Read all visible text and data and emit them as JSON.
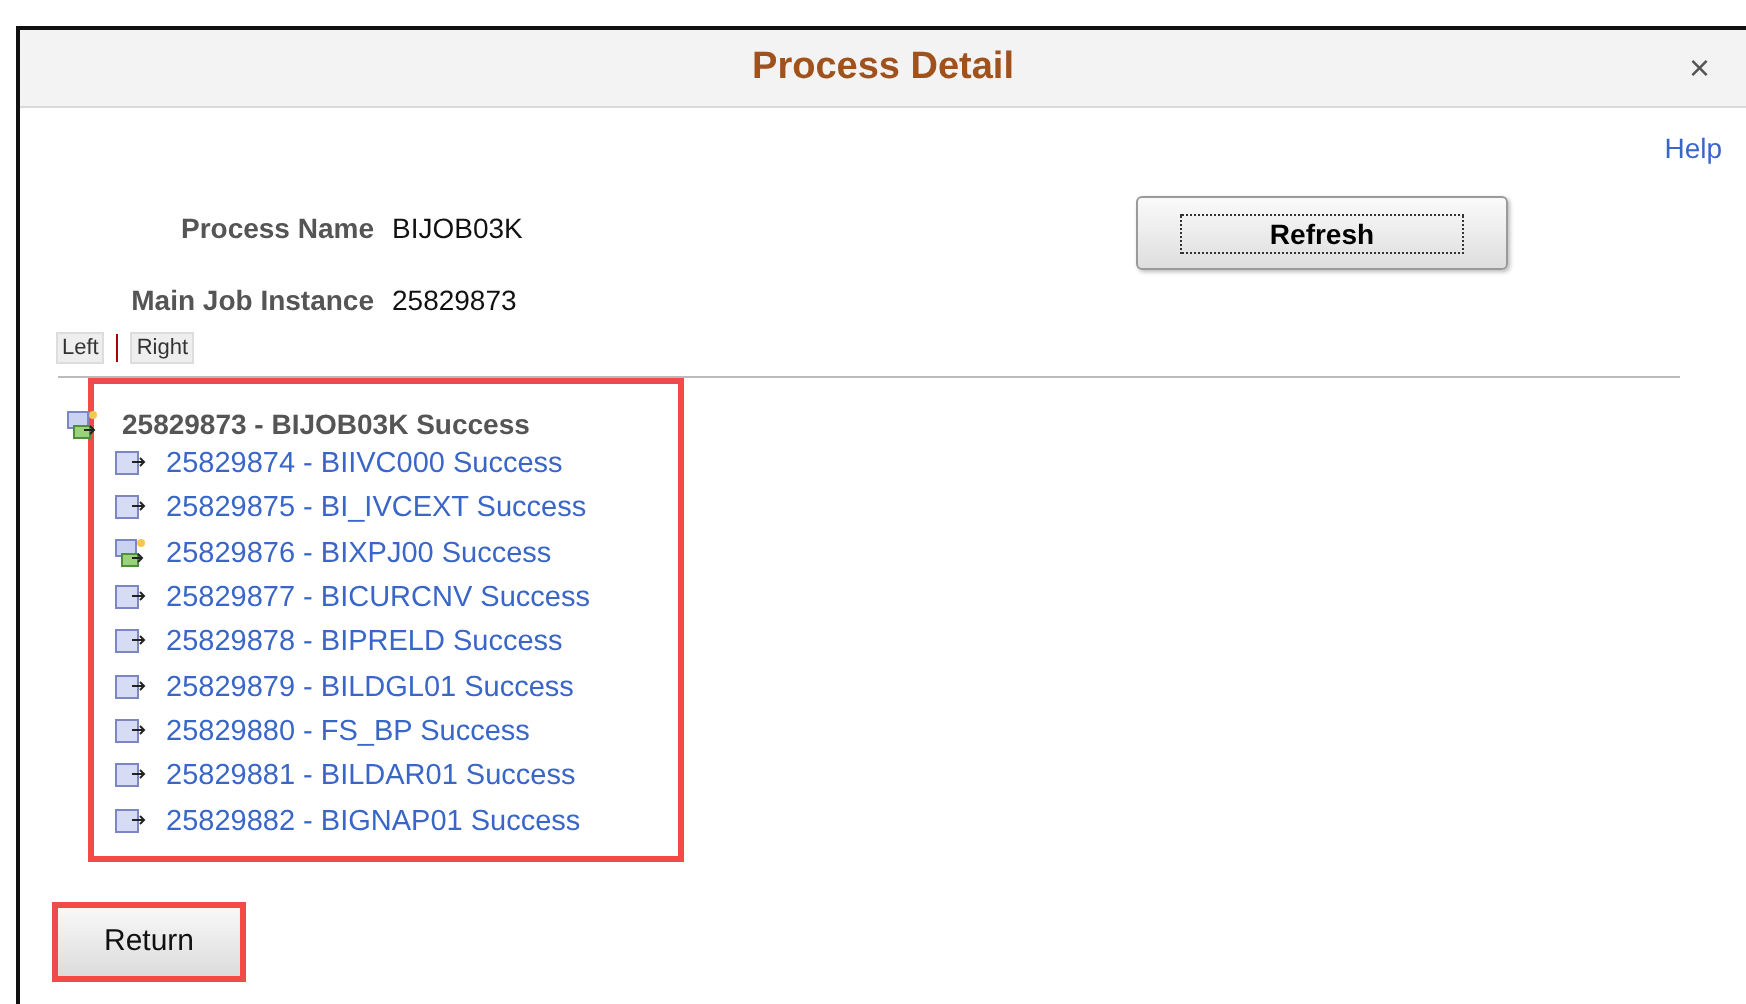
{
  "window": {
    "title": "Process Detail",
    "close": "×"
  },
  "help": "Help",
  "refresh": "Refresh",
  "fields": [
    {
      "label": "Process Name",
      "value": "BIJOB03K"
    },
    {
      "label": "Main Job Instance",
      "value": "25829873"
    }
  ],
  "toggles": [
    "Left",
    "Right"
  ],
  "tree": {
    "label": "25829873 - BIJOB03K Success",
    "kind": "job",
    "children": [
      {
        "label": "25829874 - BIIVC000 Success",
        "kind": "process"
      },
      {
        "label": "25829875 - BI_IVCEXT Success",
        "kind": "process"
      },
      {
        "label": "25829876 - BIXPJ00 Success",
        "kind": "job"
      },
      {
        "label": "25829877 - BICURCNV Success",
        "kind": "process"
      },
      {
        "label": "25829878 - BIPRELD Success",
        "kind": "process"
      },
      {
        "label": "25829879 - BILDGL01 Success",
        "kind": "process"
      },
      {
        "label": "25829880 - FS_BP Success",
        "kind": "process"
      },
      {
        "label": "25829881 - BILDAR01 Success",
        "kind": "process"
      },
      {
        "label": "25829882 - BIGNAP01 Success",
        "kind": "process"
      }
    ]
  },
  "return": "Return"
}
